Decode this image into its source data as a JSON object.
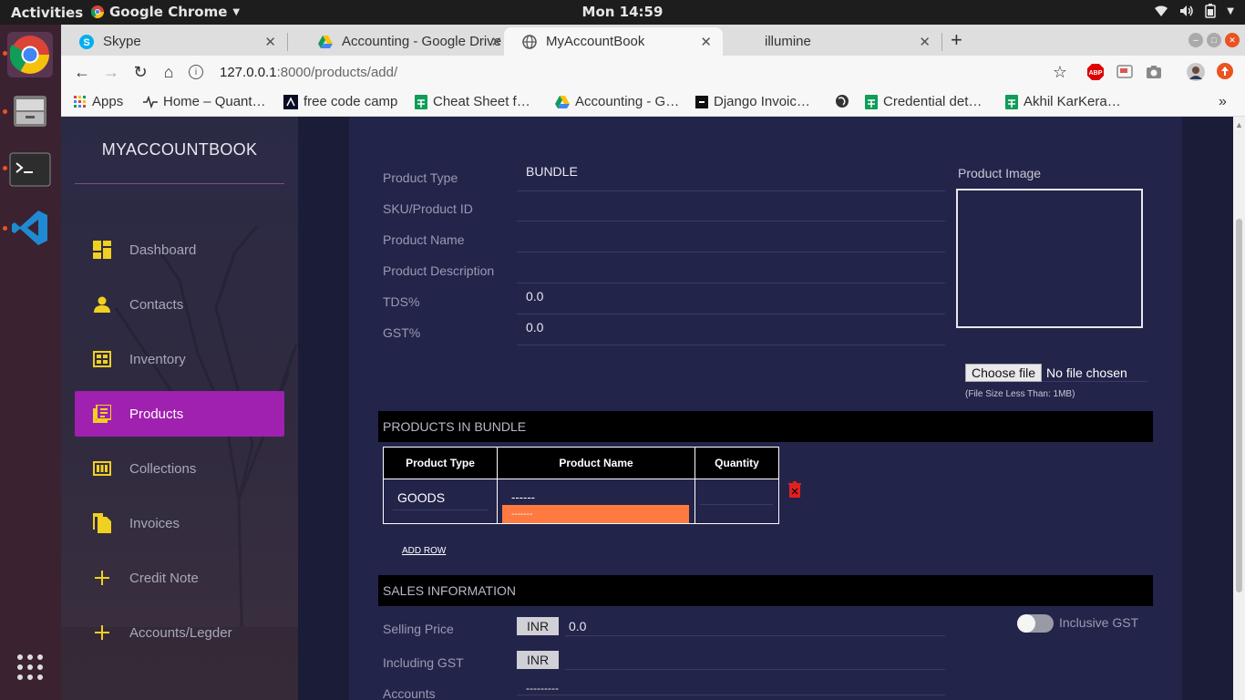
{
  "gnome": {
    "activities": "Activities",
    "app_name": "Google Chrome",
    "clock": "Mon 14:59"
  },
  "tabs": [
    {
      "title": "Skype"
    },
    {
      "title": "Accounting - Google Drive"
    },
    {
      "title": "MyAccountBook"
    },
    {
      "title": "illumine"
    }
  ],
  "address": {
    "host": "127.0.0.1",
    "path": ":8000/products/add/"
  },
  "bookmarks": [
    {
      "label": "Apps"
    },
    {
      "label": "Home – Quant…"
    },
    {
      "label": "free code camp"
    },
    {
      "label": "Cheat Sheet f…"
    },
    {
      "label": "Accounting - G…"
    },
    {
      "label": "Django Invoic…"
    },
    {
      "label": "Credential det…"
    },
    {
      "label": "Akhil KarKera…"
    }
  ],
  "sidebar": {
    "brand": "MYACCOUNTBOOK",
    "items": [
      {
        "label": "Dashboard",
        "icon": "dashboard-icon"
      },
      {
        "label": "Contacts",
        "icon": "person-icon"
      },
      {
        "label": "Inventory",
        "icon": "inventory-icon"
      },
      {
        "label": "Products",
        "icon": "products-icon",
        "active": true
      },
      {
        "label": "Collections",
        "icon": "collections-icon"
      },
      {
        "label": "Invoices",
        "icon": "invoices-icon"
      },
      {
        "label": "Credit Note",
        "icon": "plus-icon"
      },
      {
        "label": "Accounts/Legder",
        "icon": "plus-icon"
      }
    ]
  },
  "form": {
    "product_type": {
      "label": "Product Type",
      "value": "BUNDLE"
    },
    "sku": {
      "label": "SKU/Product ID",
      "value": ""
    },
    "product_name": {
      "label": "Product Name",
      "value": ""
    },
    "product_description": {
      "label": "Product Description",
      "value": ""
    },
    "tds": {
      "label": "TDS%",
      "value": "0.0"
    },
    "gst": {
      "label": "GST%",
      "value": "0.0"
    },
    "image_label": "Product Image",
    "choose_file": "Choose file",
    "no_file": "No file chosen",
    "file_note": "(File Size Less Than: 1MB)"
  },
  "bundle": {
    "section_title": "PRODUCTS IN BUNDLE",
    "columns": [
      "Product Type",
      "Product Name",
      "Quantity"
    ],
    "row": {
      "product_type": "GOODS",
      "product_name": "------",
      "dropdown_option": "-------",
      "quantity": ""
    },
    "add_row": "ADD ROW"
  },
  "sales": {
    "section_title": "SALES INFORMATION",
    "selling_price": {
      "label": "Selling Price",
      "currency": "INR",
      "value": "0.0"
    },
    "including_gst": {
      "label": "Including GST",
      "currency": "INR",
      "value": ""
    },
    "accounts": {
      "label": "Accounts",
      "value": "---------"
    },
    "inclusive_gst": {
      "label": "Inclusive GST",
      "checked": false
    }
  },
  "colors": {
    "active_nav": "#a020b0",
    "accent_yellow": "#f0d020",
    "dropdown_highlight": "#ff7a40",
    "delete_red": "#e02020"
  }
}
